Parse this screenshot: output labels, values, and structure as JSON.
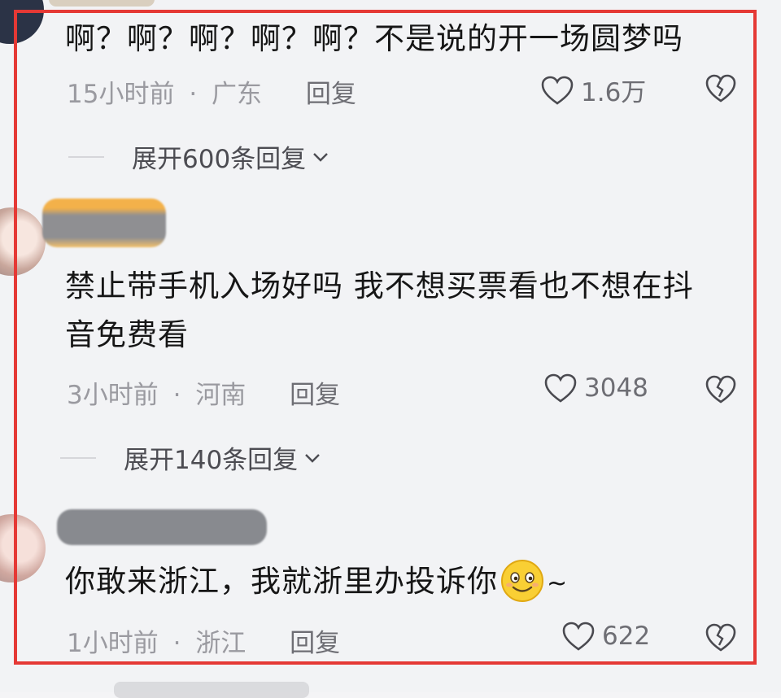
{
  "comments": [
    {
      "text": "啊？啊？啊？啊？啊？不是说的开一场圆梦吗",
      "time": "15小时前",
      "sep": "·",
      "region": "广东",
      "reply_label": "回复",
      "likes": "1.6万",
      "expand_label": "展开600条回复"
    },
    {
      "text_line1": "禁止带手机入场好吗 我不想买票看也不想在抖",
      "text_line2": "音免费看",
      "time": "3小时前",
      "sep": "·",
      "region": "河南",
      "reply_label": "回复",
      "likes": "3048",
      "expand_label": "展开140条回复"
    },
    {
      "text": "你敢来浙江，我就浙里办投诉你",
      "emoji": "smiley-face-emoji",
      "text_tail": "~",
      "time": "1小时前",
      "sep": "·",
      "region": "浙江",
      "reply_label": "回复",
      "likes": "622"
    }
  ],
  "colors": {
    "highlight_frame": "#e53935",
    "primary_text": "#161616",
    "meta_text": "#9a9aa0",
    "background": "#f2f3f5"
  }
}
